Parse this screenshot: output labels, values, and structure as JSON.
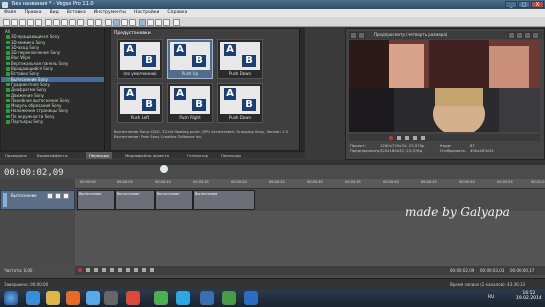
{
  "window": {
    "title": "Без названия * - Vegas Pro 11.0",
    "min": "_",
    "max": "□",
    "close": "X"
  },
  "menu": [
    "Файл",
    "Правка",
    "Вид",
    "Вставка",
    "Инструменты",
    "Настройки",
    "Справка"
  ],
  "fx_tree": {
    "root": "All",
    "items": [
      "3D-вращающиеся Sony",
      "3D-мимика Sony",
      "3D-вход Sony",
      "3D-переключение Sony",
      "Blur Wipe",
      "Вертикальная панель Sony",
      "Вращающийся Sony",
      "Вставка Sony",
      "Вытеснение Sony",
      "Градиентная Sony",
      "Диафрагма Sony",
      "Движение Sony",
      "Линейное вытеснение Sony",
      "Модуль обрезания Sony",
      "Наложение страницы Sony",
      "По окружности Sony",
      "Портьеры Sony"
    ],
    "selected_index": 8
  },
  "presets": {
    "header": "Предустановки",
    "items": [
      "(по умолчанию)",
      "Push Up",
      "Push Down",
      "Push Left",
      "Push Right",
      "Push Down"
    ],
    "selected_index": 1,
    "info_lines": [
      "Вытеснение Sony: DXG, 32-bit floating point, GPU Accelerated, Grouping Sony, Version 1.0",
      "Вытеснение: Free Sony Creative Software Inc."
    ]
  },
  "tabs": [
    "Проводник",
    "Видеоэффекты",
    "Переходы",
    "Медиафайлы проекта",
    "Генератор",
    "Переходы"
  ],
  "preview": {
    "mode": "Предпросмотр (четверть размера)",
    "info_labels": [
      "Проект:",
      "Предпросмотр:",
      "Кадр:",
      "Отображать:"
    ],
    "info_values": [
      "1280x720x32; 23,976р",
      "320x180x32; 23,976р",
      "87",
      "490x263x32"
    ]
  },
  "timeline": {
    "timecode": "00:00:02,09",
    "track_label": "Вытеснение",
    "ruler_marks": [
      "00:00:00",
      "00:00:05",
      "00:00:10",
      "00:00:15",
      "00:00:20",
      "00:00:25",
      "00:00:30",
      "00:00:35",
      "00:00:40",
      "00:00:45",
      "00:00:50",
      "00:00:55",
      "00:01:0"
    ],
    "clips": [
      "Вытеснение",
      "Вытеснение",
      "Вытеснение",
      "Вытеснение"
    ],
    "rate_label": "Частота: 0,00",
    "watermark": "made by Galyapa",
    "transport_time": "00:00:02,09",
    "end_time": "00:00:03,03",
    "total_time": "00:00:00,17"
  },
  "status": {
    "left": "Завершено: 00:00:00",
    "right": "Время записи (2 каналов): 43:36:33"
  },
  "taskbar": {
    "lang": "RU",
    "time": "16:52",
    "date": "19.02.2014"
  }
}
